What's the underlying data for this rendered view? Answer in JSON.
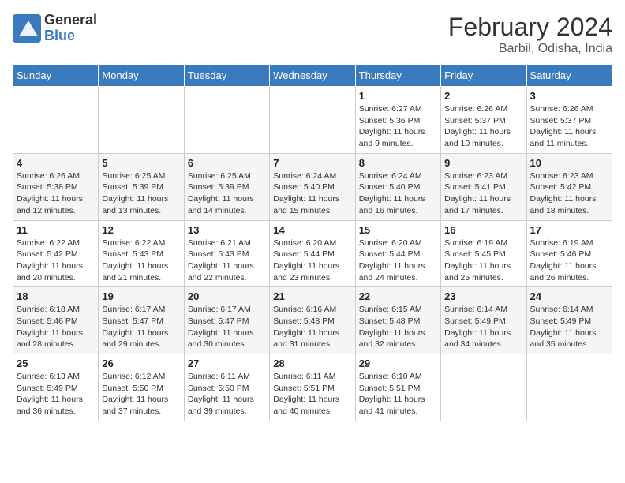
{
  "header": {
    "logo_line1": "General",
    "logo_line2": "Blue",
    "month_year": "February 2024",
    "location": "Barbil, Odisha, India"
  },
  "weekdays": [
    "Sunday",
    "Monday",
    "Tuesday",
    "Wednesday",
    "Thursday",
    "Friday",
    "Saturday"
  ],
  "weeks": [
    [
      {
        "day": "",
        "info": ""
      },
      {
        "day": "",
        "info": ""
      },
      {
        "day": "",
        "info": ""
      },
      {
        "day": "",
        "info": ""
      },
      {
        "day": "1",
        "info": "Sunrise: 6:27 AM\nSunset: 5:36 PM\nDaylight: 11 hours\nand 9 minutes."
      },
      {
        "day": "2",
        "info": "Sunrise: 6:26 AM\nSunset: 5:37 PM\nDaylight: 11 hours\nand 10 minutes."
      },
      {
        "day": "3",
        "info": "Sunrise: 6:26 AM\nSunset: 5:37 PM\nDaylight: 11 hours\nand 11 minutes."
      }
    ],
    [
      {
        "day": "4",
        "info": "Sunrise: 6:26 AM\nSunset: 5:38 PM\nDaylight: 11 hours\nand 12 minutes."
      },
      {
        "day": "5",
        "info": "Sunrise: 6:25 AM\nSunset: 5:39 PM\nDaylight: 11 hours\nand 13 minutes."
      },
      {
        "day": "6",
        "info": "Sunrise: 6:25 AM\nSunset: 5:39 PM\nDaylight: 11 hours\nand 14 minutes."
      },
      {
        "day": "7",
        "info": "Sunrise: 6:24 AM\nSunset: 5:40 PM\nDaylight: 11 hours\nand 15 minutes."
      },
      {
        "day": "8",
        "info": "Sunrise: 6:24 AM\nSunset: 5:40 PM\nDaylight: 11 hours\nand 16 minutes."
      },
      {
        "day": "9",
        "info": "Sunrise: 6:23 AM\nSunset: 5:41 PM\nDaylight: 11 hours\nand 17 minutes."
      },
      {
        "day": "10",
        "info": "Sunrise: 6:23 AM\nSunset: 5:42 PM\nDaylight: 11 hours\nand 18 minutes."
      }
    ],
    [
      {
        "day": "11",
        "info": "Sunrise: 6:22 AM\nSunset: 5:42 PM\nDaylight: 11 hours\nand 20 minutes."
      },
      {
        "day": "12",
        "info": "Sunrise: 6:22 AM\nSunset: 5:43 PM\nDaylight: 11 hours\nand 21 minutes."
      },
      {
        "day": "13",
        "info": "Sunrise: 6:21 AM\nSunset: 5:43 PM\nDaylight: 11 hours\nand 22 minutes."
      },
      {
        "day": "14",
        "info": "Sunrise: 6:20 AM\nSunset: 5:44 PM\nDaylight: 11 hours\nand 23 minutes."
      },
      {
        "day": "15",
        "info": "Sunrise: 6:20 AM\nSunset: 5:44 PM\nDaylight: 11 hours\nand 24 minutes."
      },
      {
        "day": "16",
        "info": "Sunrise: 6:19 AM\nSunset: 5:45 PM\nDaylight: 11 hours\nand 25 minutes."
      },
      {
        "day": "17",
        "info": "Sunrise: 6:19 AM\nSunset: 5:46 PM\nDaylight: 11 hours\nand 26 minutes."
      }
    ],
    [
      {
        "day": "18",
        "info": "Sunrise: 6:18 AM\nSunset: 5:46 PM\nDaylight: 11 hours\nand 28 minutes."
      },
      {
        "day": "19",
        "info": "Sunrise: 6:17 AM\nSunset: 5:47 PM\nDaylight: 11 hours\nand 29 minutes."
      },
      {
        "day": "20",
        "info": "Sunrise: 6:17 AM\nSunset: 5:47 PM\nDaylight: 11 hours\nand 30 minutes."
      },
      {
        "day": "21",
        "info": "Sunrise: 6:16 AM\nSunset: 5:48 PM\nDaylight: 11 hours\nand 31 minutes."
      },
      {
        "day": "22",
        "info": "Sunrise: 6:15 AM\nSunset: 5:48 PM\nDaylight: 11 hours\nand 32 minutes."
      },
      {
        "day": "23",
        "info": "Sunrise: 6:14 AM\nSunset: 5:49 PM\nDaylight: 11 hours\nand 34 minutes."
      },
      {
        "day": "24",
        "info": "Sunrise: 6:14 AM\nSunset: 5:49 PM\nDaylight: 11 hours\nand 35 minutes."
      }
    ],
    [
      {
        "day": "25",
        "info": "Sunrise: 6:13 AM\nSunset: 5:49 PM\nDaylight: 11 hours\nand 36 minutes."
      },
      {
        "day": "26",
        "info": "Sunrise: 6:12 AM\nSunset: 5:50 PM\nDaylight: 11 hours\nand 37 minutes."
      },
      {
        "day": "27",
        "info": "Sunrise: 6:11 AM\nSunset: 5:50 PM\nDaylight: 11 hours\nand 39 minutes."
      },
      {
        "day": "28",
        "info": "Sunrise: 6:11 AM\nSunset: 5:51 PM\nDaylight: 11 hours\nand 40 minutes."
      },
      {
        "day": "29",
        "info": "Sunrise: 6:10 AM\nSunset: 5:51 PM\nDaylight: 11 hours\nand 41 minutes."
      },
      {
        "day": "",
        "info": ""
      },
      {
        "day": "",
        "info": ""
      }
    ]
  ]
}
